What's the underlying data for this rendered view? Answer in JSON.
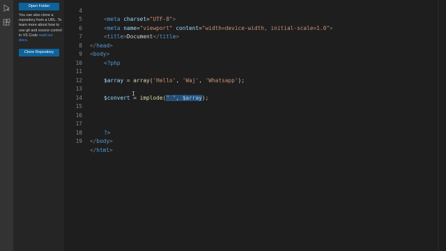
{
  "sidebar": {
    "open_folder_label": "Open Folder",
    "info_text": "You can also clone a repository from a URL. To learn more about how to use git and source control in VS Code ",
    "info_link": "read our docs",
    "info_end": ".",
    "clone_repo_label": "Clone Repository"
  },
  "activity": {
    "icons": [
      "run-debug-icon",
      "extensions-icon"
    ]
  },
  "editor": {
    "lines": [
      {
        "num": "4"
      },
      {
        "num": "5"
      },
      {
        "num": "6"
      },
      {
        "num": "7"
      },
      {
        "num": "8"
      },
      {
        "num": "9"
      },
      {
        "num": "10"
      },
      {
        "num": "11"
      },
      {
        "num": "12"
      },
      {
        "num": "13"
      },
      {
        "num": "14"
      },
      {
        "num": "15"
      },
      {
        "num": "16"
      },
      {
        "num": "17"
      },
      {
        "num": "18"
      },
      {
        "num": "19"
      }
    ],
    "code": {
      "l4_meta": "meta",
      "l4_attr": "charset",
      "l4_val": "\"UTF-8\"",
      "l5_meta": "meta",
      "l5_attr1": "name",
      "l5_val1": "\"viewport\"",
      "l5_attr2": "content",
      "l5_val2": "\"width=device-width, initial-scale=1.0\"",
      "l6_tag": "title",
      "l6_text": "Document",
      "l6_tag_close": "title",
      "l7_tag": "head",
      "l8_tag": "body",
      "l9_php": "<?php",
      "l11_var": "$array",
      "l11_eq": " = ",
      "l11_fn": "array",
      "l11_open": "(",
      "l11_s1": "'Hello'",
      "l11_c1": ", ",
      "l11_s2": "'Waj'",
      "l11_c2": ", ",
      "l11_s3": "'Whatsapp'",
      "l11_close": ");",
      "l13_var": "$convert",
      "l13_eq": " = ",
      "l13_fn": "implode",
      "l13_open": "(",
      "l13_str": "\" \"",
      "l13_sep": ", ",
      "l13_arg": "$array",
      "l13_close": ");",
      "l17_php": "?>",
      "l18_tag": "body",
      "l19_tag": "html"
    }
  }
}
